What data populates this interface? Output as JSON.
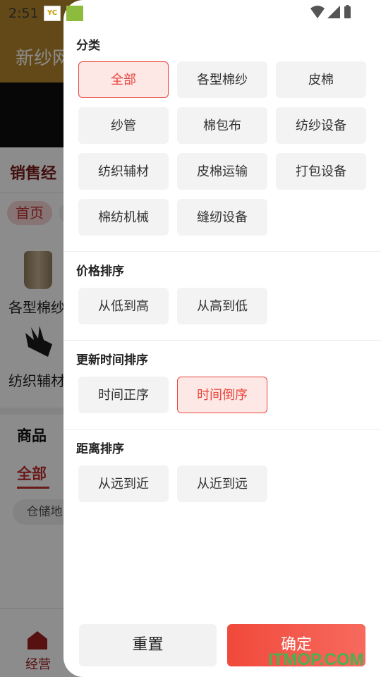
{
  "status_bar": {
    "time": "2:51",
    "app_icon_1": "yc-app-icon",
    "app_icon_2": "green-app-icon"
  },
  "background": {
    "header_title": "新纱网",
    "sales_title": "销售经",
    "home_pill": "首页",
    "category_1": "各型棉纱",
    "category_2": "纺织辅材",
    "goods_tab": "商品",
    "all_tab": "全部",
    "storage_filter": "仓储地",
    "bottom_tab": "经营"
  },
  "drawer": {
    "category": {
      "title": "分类",
      "options": [
        "全部",
        "各型棉纱",
        "皮棉",
        "纱管",
        "棉包布",
        "纺纱设备",
        "纺织辅材",
        "皮棉运输",
        "打包设备",
        "棉纺机械",
        "缝纫设备"
      ],
      "selected": "全部"
    },
    "price_sort": {
      "title": "价格排序",
      "options": [
        "从低到高",
        "从高到低"
      ]
    },
    "time_sort": {
      "title": "更新时间排序",
      "options": [
        "时间正序",
        "时间倒序"
      ],
      "selected": "时间倒序"
    },
    "distance_sort": {
      "title": "距离排序",
      "options": [
        "从远到近",
        "从近到远"
      ]
    },
    "reset_label": "重置",
    "confirm_label": "确定"
  },
  "watermark": "ITMOP.COM",
  "colors": {
    "accent": "#e8463c",
    "accent_bg": "#fde8e6",
    "header_brown": "#b7862c"
  }
}
